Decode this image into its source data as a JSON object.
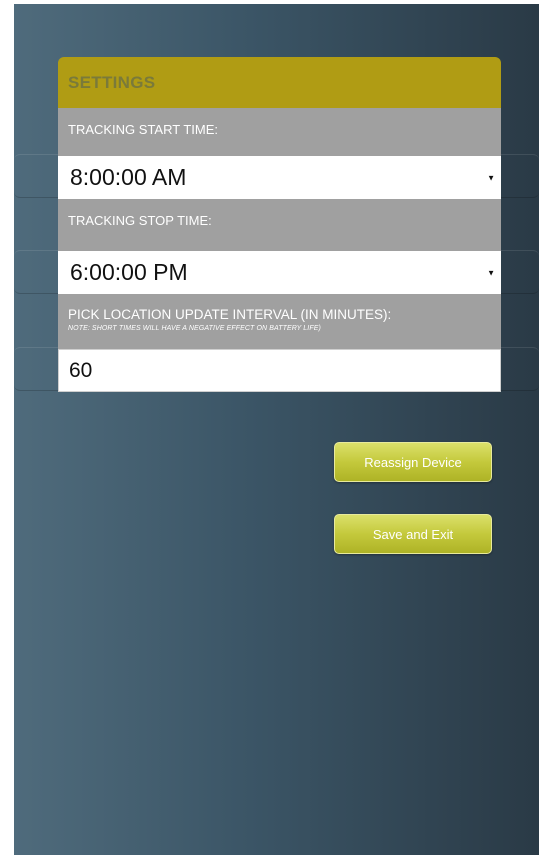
{
  "settings": {
    "title": "SETTINGS",
    "start_label": "TRACKING START TIME:",
    "start_value": "8:00:00 AM",
    "stop_label": "TRACKING STOP TIME:",
    "stop_value": "6:00:00 PM",
    "interval_label": "PICK LOCATION UPDATE INTERVAL (IN MINUTES):",
    "interval_note": "NOTE: SHORT TIMES WILL HAVE A NEGATIVE EFFECT ON BATTERY LIFE)",
    "interval_value": "60",
    "dropdown_icon": "caret-down-icon"
  },
  "actions": {
    "reassign_label": "Reassign Device",
    "save_label": "Save and Exit"
  },
  "colors": {
    "header": "#b09c14",
    "section": "#a0a0a0",
    "button": "#c4c93c"
  }
}
